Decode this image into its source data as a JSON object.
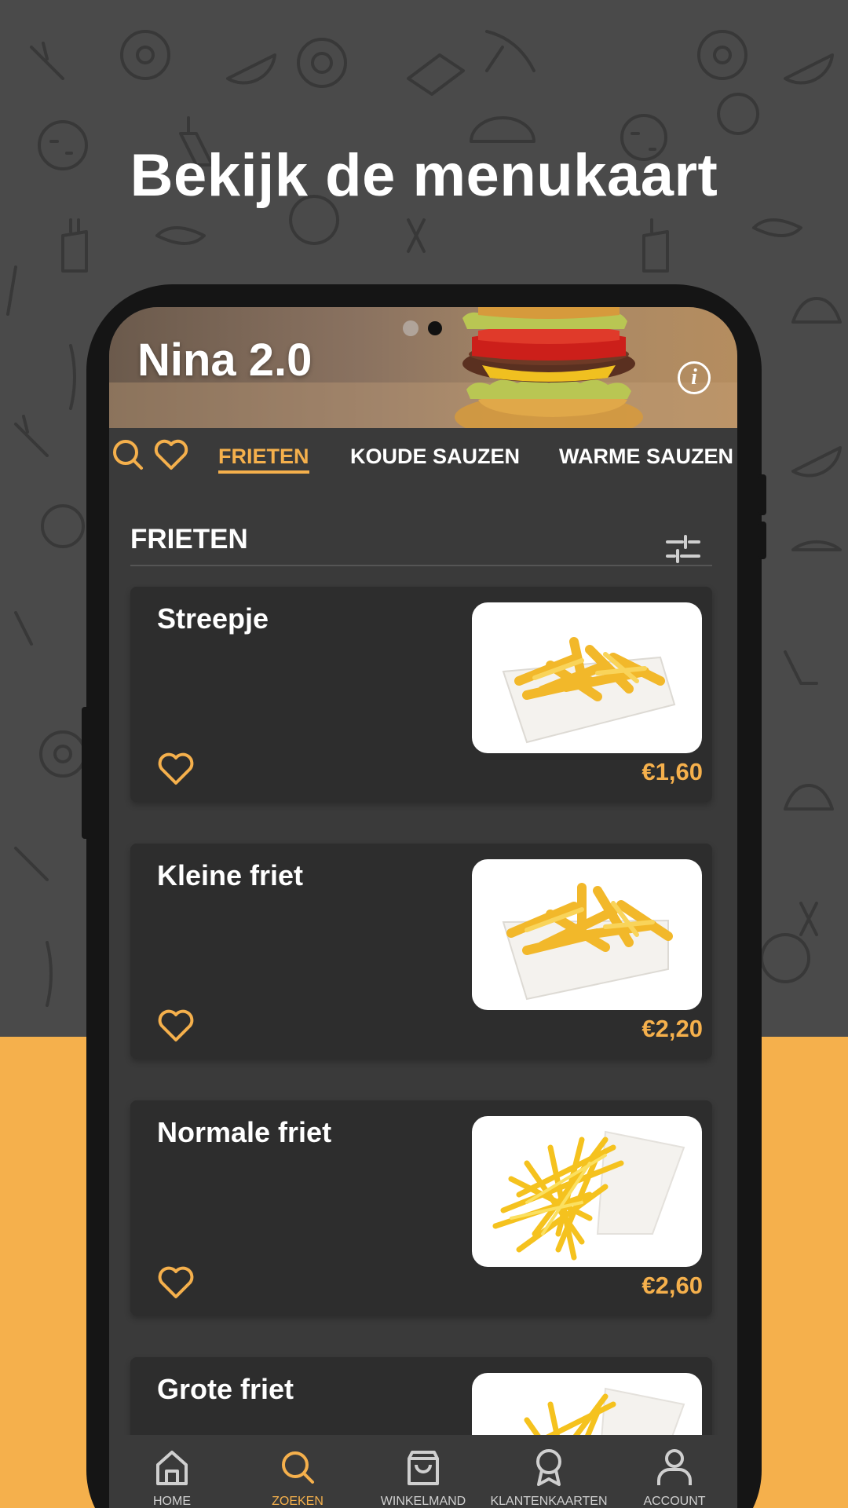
{
  "headline": "Bekijk de menukaart",
  "hero": {
    "title": "Nina 2.0",
    "info_label": "i"
  },
  "categories": [
    {
      "label": "FRIETEN",
      "active": true
    },
    {
      "label": "KOUDE SAUZEN",
      "active": false
    },
    {
      "label": "WARME SAUZEN",
      "active": false
    }
  ],
  "section": {
    "title": "FRIETEN"
  },
  "products": [
    {
      "name": "Streepje",
      "price": "€1,60"
    },
    {
      "name": "Kleine friet",
      "price": "€2,20"
    },
    {
      "name": "Normale friet",
      "price": "€2,60"
    },
    {
      "name": "Grote friet",
      "price": ""
    }
  ],
  "bottom_nav": [
    {
      "label": "HOME",
      "icon": "home-icon",
      "active": false
    },
    {
      "label": "ZOEKEN",
      "icon": "search-icon",
      "active": true
    },
    {
      "label": "WINKELMAND",
      "icon": "shopping-bag-icon",
      "active": false
    },
    {
      "label": "KLANTENKAARTEN",
      "icon": "award-icon",
      "active": false
    },
    {
      "label": "ACCOUNT",
      "icon": "user-icon",
      "active": false
    }
  ],
  "colors": {
    "accent": "#f5b04c",
    "background": "#4a4a4a",
    "screen": "#3a3a3a",
    "card": "#2d2d2d"
  }
}
